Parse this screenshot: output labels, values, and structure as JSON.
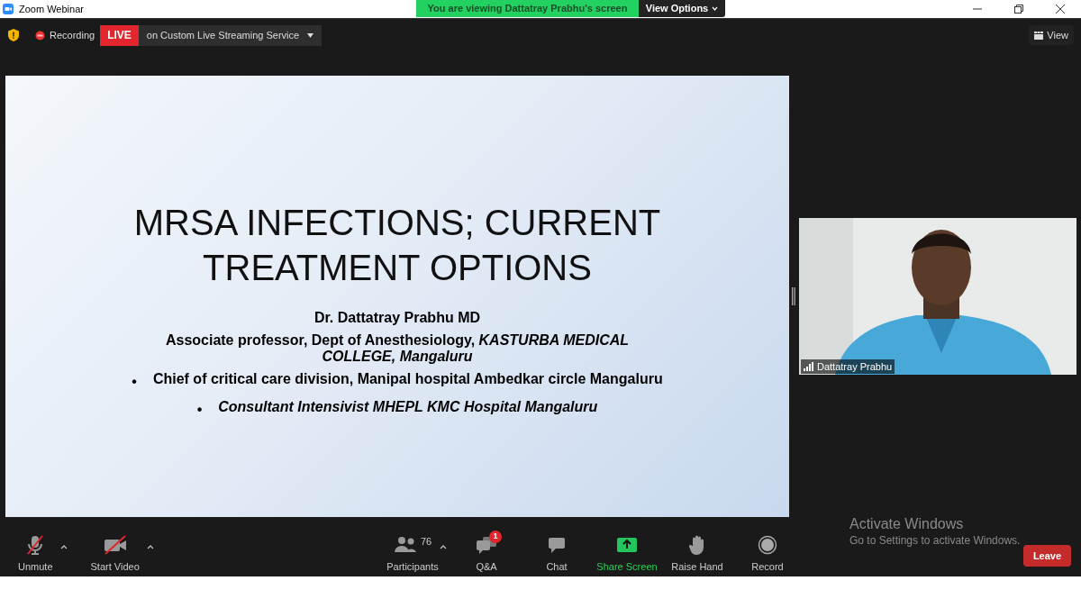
{
  "window": {
    "title": "Zoom Webinar"
  },
  "viewing_banner": {
    "text": "You are viewing Dattatray Prabhu's screen",
    "options": "View Options"
  },
  "meeting_bar": {
    "recording": "Recording",
    "live": "LIVE",
    "stream": "on Custom Live Streaming Service",
    "view": "View"
  },
  "slide": {
    "title": "MRSA INFECTIONS; CURRENT TREATMENT OPTIONS",
    "lines": [
      {
        "kind": "plain",
        "text": "Dr. Dattatray Prabhu MD",
        "italic": false
      },
      {
        "kind": "plain",
        "text": "Associate professor, Dept of Anesthesiology, *KASTURBA MEDICAL COLLEGE, Mangaluru*",
        "italic": false
      },
      {
        "kind": "bullet",
        "bullet": "•",
        "text": "Chief of critical care division, Manipal hospital Ambedkar circle Mangaluru",
        "italic": false
      },
      {
        "kind": "bullet",
        "bullet": "•",
        "text": "Consultant Intensivist MHEPL KMC Hospital Mangaluru",
        "italic": true
      }
    ]
  },
  "video_tile": {
    "name": "Dattatray Prabhu"
  },
  "toolbar": {
    "left": [
      {
        "kind": "mic",
        "label": "Unmute",
        "muted": true
      },
      {
        "kind": "camera",
        "label": "Start Video",
        "muted": true
      }
    ],
    "center": [
      {
        "kind": "participants",
        "label": "Participants",
        "count": "76",
        "caret": true
      },
      {
        "kind": "qa",
        "label": "Q&A",
        "badge": "1"
      },
      {
        "kind": "chat",
        "label": "Chat"
      },
      {
        "kind": "share",
        "label": "Share Screen"
      },
      {
        "kind": "hand",
        "label": "Raise Hand"
      },
      {
        "kind": "record",
        "label": "Record"
      }
    ],
    "leave": "Leave"
  },
  "os_notice": {
    "title": "Activate Windows",
    "text": "Go to Settings to activate Windows."
  }
}
